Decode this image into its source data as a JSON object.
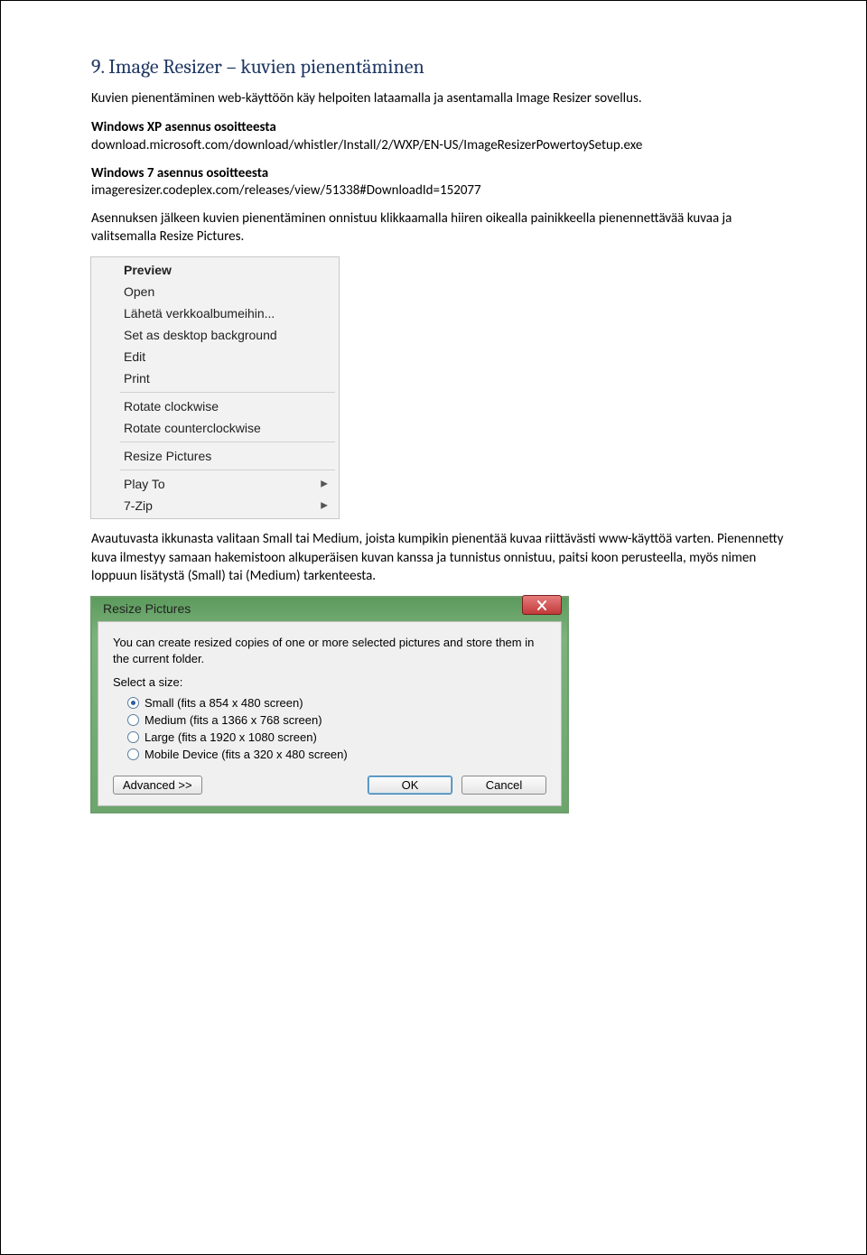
{
  "heading": "9.  Image Resizer – kuvien pienentäminen",
  "intro_paragraph": "Kuvien pienentäminen web-käyttöön käy helpoiten lataamalla ja asentamalla Image Resizer sovellus.",
  "xp_install": {
    "label": "Windows XP asennus osoitteesta",
    "url": "download.microsoft.com/download/whistler/Install/2/WXP/EN-US/ImageResizerPowertoySetup.exe"
  },
  "win7_install": {
    "label": "Windows 7 asennus osoitteesta",
    "url": "imageresizer.codeplex.com/releases/view/51338#DownloadId=152077"
  },
  "after_install": "Asennuksen jälkeen kuvien pienentäminen onnistuu klikkaamalla hiiren oikealla painikkeella pienennettävää kuvaa ja valitsemalla Resize Pictures.",
  "context_menu": {
    "items": [
      {
        "label": "Preview",
        "bold": true
      },
      {
        "label": "Open"
      },
      {
        "label": "Lähetä verkkoalbumeihin..."
      },
      {
        "label": "Set as desktop background"
      },
      {
        "label": "Edit"
      },
      {
        "label": "Print"
      },
      {
        "sep": true
      },
      {
        "label": "Rotate clockwise"
      },
      {
        "label": "Rotate counterclockwise"
      },
      {
        "sep": true
      },
      {
        "label": "Resize Pictures"
      },
      {
        "sep": true
      },
      {
        "label": "Play To",
        "submenu": true
      },
      {
        "label": "7-Zip",
        "submenu": true
      }
    ]
  },
  "post_menu_paragraph": "Avautuvasta ikkunasta valitaan Small tai Medium, joista kumpikin pienentää kuvaa riittävästi www-käyttöä varten. Pienennetty kuva ilmestyy samaan hakemistoon alkuperäisen kuvan kanssa ja tunnistus onnistuu, paitsi koon perusteella, myös nimen loppuun lisätystä (Small) tai (Medium) tarkenteesta.",
  "dialog": {
    "title": "Resize Pictures",
    "intro": "You can create resized copies of one or more selected pictures and store them in the current folder.",
    "select_label": "Select a size:",
    "options": [
      {
        "label": "Small (fits a 854 x 480 screen)",
        "checked": true
      },
      {
        "label": "Medium (fits a 1366 x 768 screen)",
        "checked": false
      },
      {
        "label": "Large (fits a 1920 x 1080 screen)",
        "checked": false
      },
      {
        "label": "Mobile Device (fits a 320 x 480 screen)",
        "checked": false
      }
    ],
    "buttons": {
      "advanced": "Advanced >>",
      "ok": "OK",
      "cancel": "Cancel"
    }
  }
}
